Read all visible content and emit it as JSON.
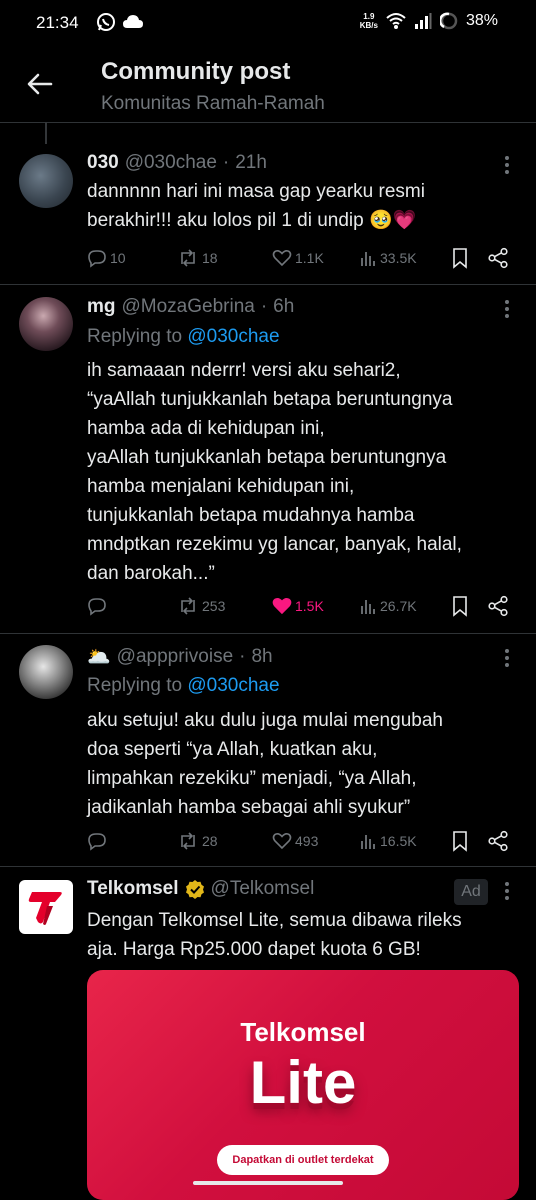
{
  "status_bar": {
    "time": "21:34",
    "net_speed_value": "1.9",
    "net_speed_unit": "KB/s",
    "battery": "38%"
  },
  "header": {
    "title": "Community post",
    "subtitle": "Komunitas Ramah-Ramah"
  },
  "tweets": [
    {
      "name": "030",
      "handle": "@030chae",
      "dot": "·",
      "time": "21h",
      "text_lines": [
        "dannnnn hari ini masa gap yearku resmi",
        "berakhir!!! aku lolos pil 1 di undip 🥹💗"
      ],
      "replies": "10",
      "reposts": "18",
      "likes": "1.1K",
      "views": "33.5K"
    },
    {
      "name": "mg",
      "handle": "@MozaGebrina",
      "dot": "·",
      "time": "6h",
      "replying_prefix": "Replying to",
      "replying_to": "@030chae",
      "text_lines": [
        "ih samaaan nderrr! versi aku sehari2,",
        "“yaAllah tunjukkanlah betapa beruntungnya",
        "hamba ada di kehidupan ini,",
        "yaAllah tunjukkanlah betapa beruntungnya",
        "hamba menjalani kehidupan ini,",
        "tunjukkanlah betapa mudahnya hamba",
        "mndptkan rezekimu yg lancar, banyak, halal,",
        "dan barokah...”"
      ],
      "replies": "",
      "reposts": "253",
      "likes": "1.5K",
      "views": "26.7K"
    },
    {
      "name": "🌥️",
      "handle": "@appprivoise",
      "dot": "·",
      "time": "8h",
      "replying_prefix": "Replying to",
      "replying_to": "@030chae",
      "text_lines": [
        "aku setuju! aku dulu juga mulai mengubah",
        "doa seperti “ya Allah, kuatkan aku,",
        "limpahkan rezekiku” menjadi, “ya Allah,",
        "jadikanlah hamba sebagai ahli syukur”"
      ],
      "replies": "",
      "reposts": "28",
      "likes": "493",
      "views": "16.5K"
    }
  ],
  "ad": {
    "name": "Telkomsel",
    "handle": "@Telkomsel",
    "badge": "Ad",
    "text_lines": [
      "Dengan Telkomsel Lite, semua dibawa rileks",
      "aja. Harga Rp25.000 dapet kuota 6 GB!"
    ],
    "card_brand": "Telkomsel",
    "card_product": "Lite",
    "card_cta": "Dapatkan di outlet terdekat"
  },
  "colors": {
    "background": "#000000",
    "text": "#e7e9ea",
    "muted": "#71767b",
    "link": "#1d9bf0",
    "like_active": "#f91880",
    "brand_red": "#e4002b"
  },
  "icons": [
    "back-arrow-icon",
    "reply-icon",
    "repost-icon",
    "like-icon",
    "views-icon",
    "bookmark-icon",
    "share-icon",
    "more-icon",
    "verified-icon"
  ]
}
